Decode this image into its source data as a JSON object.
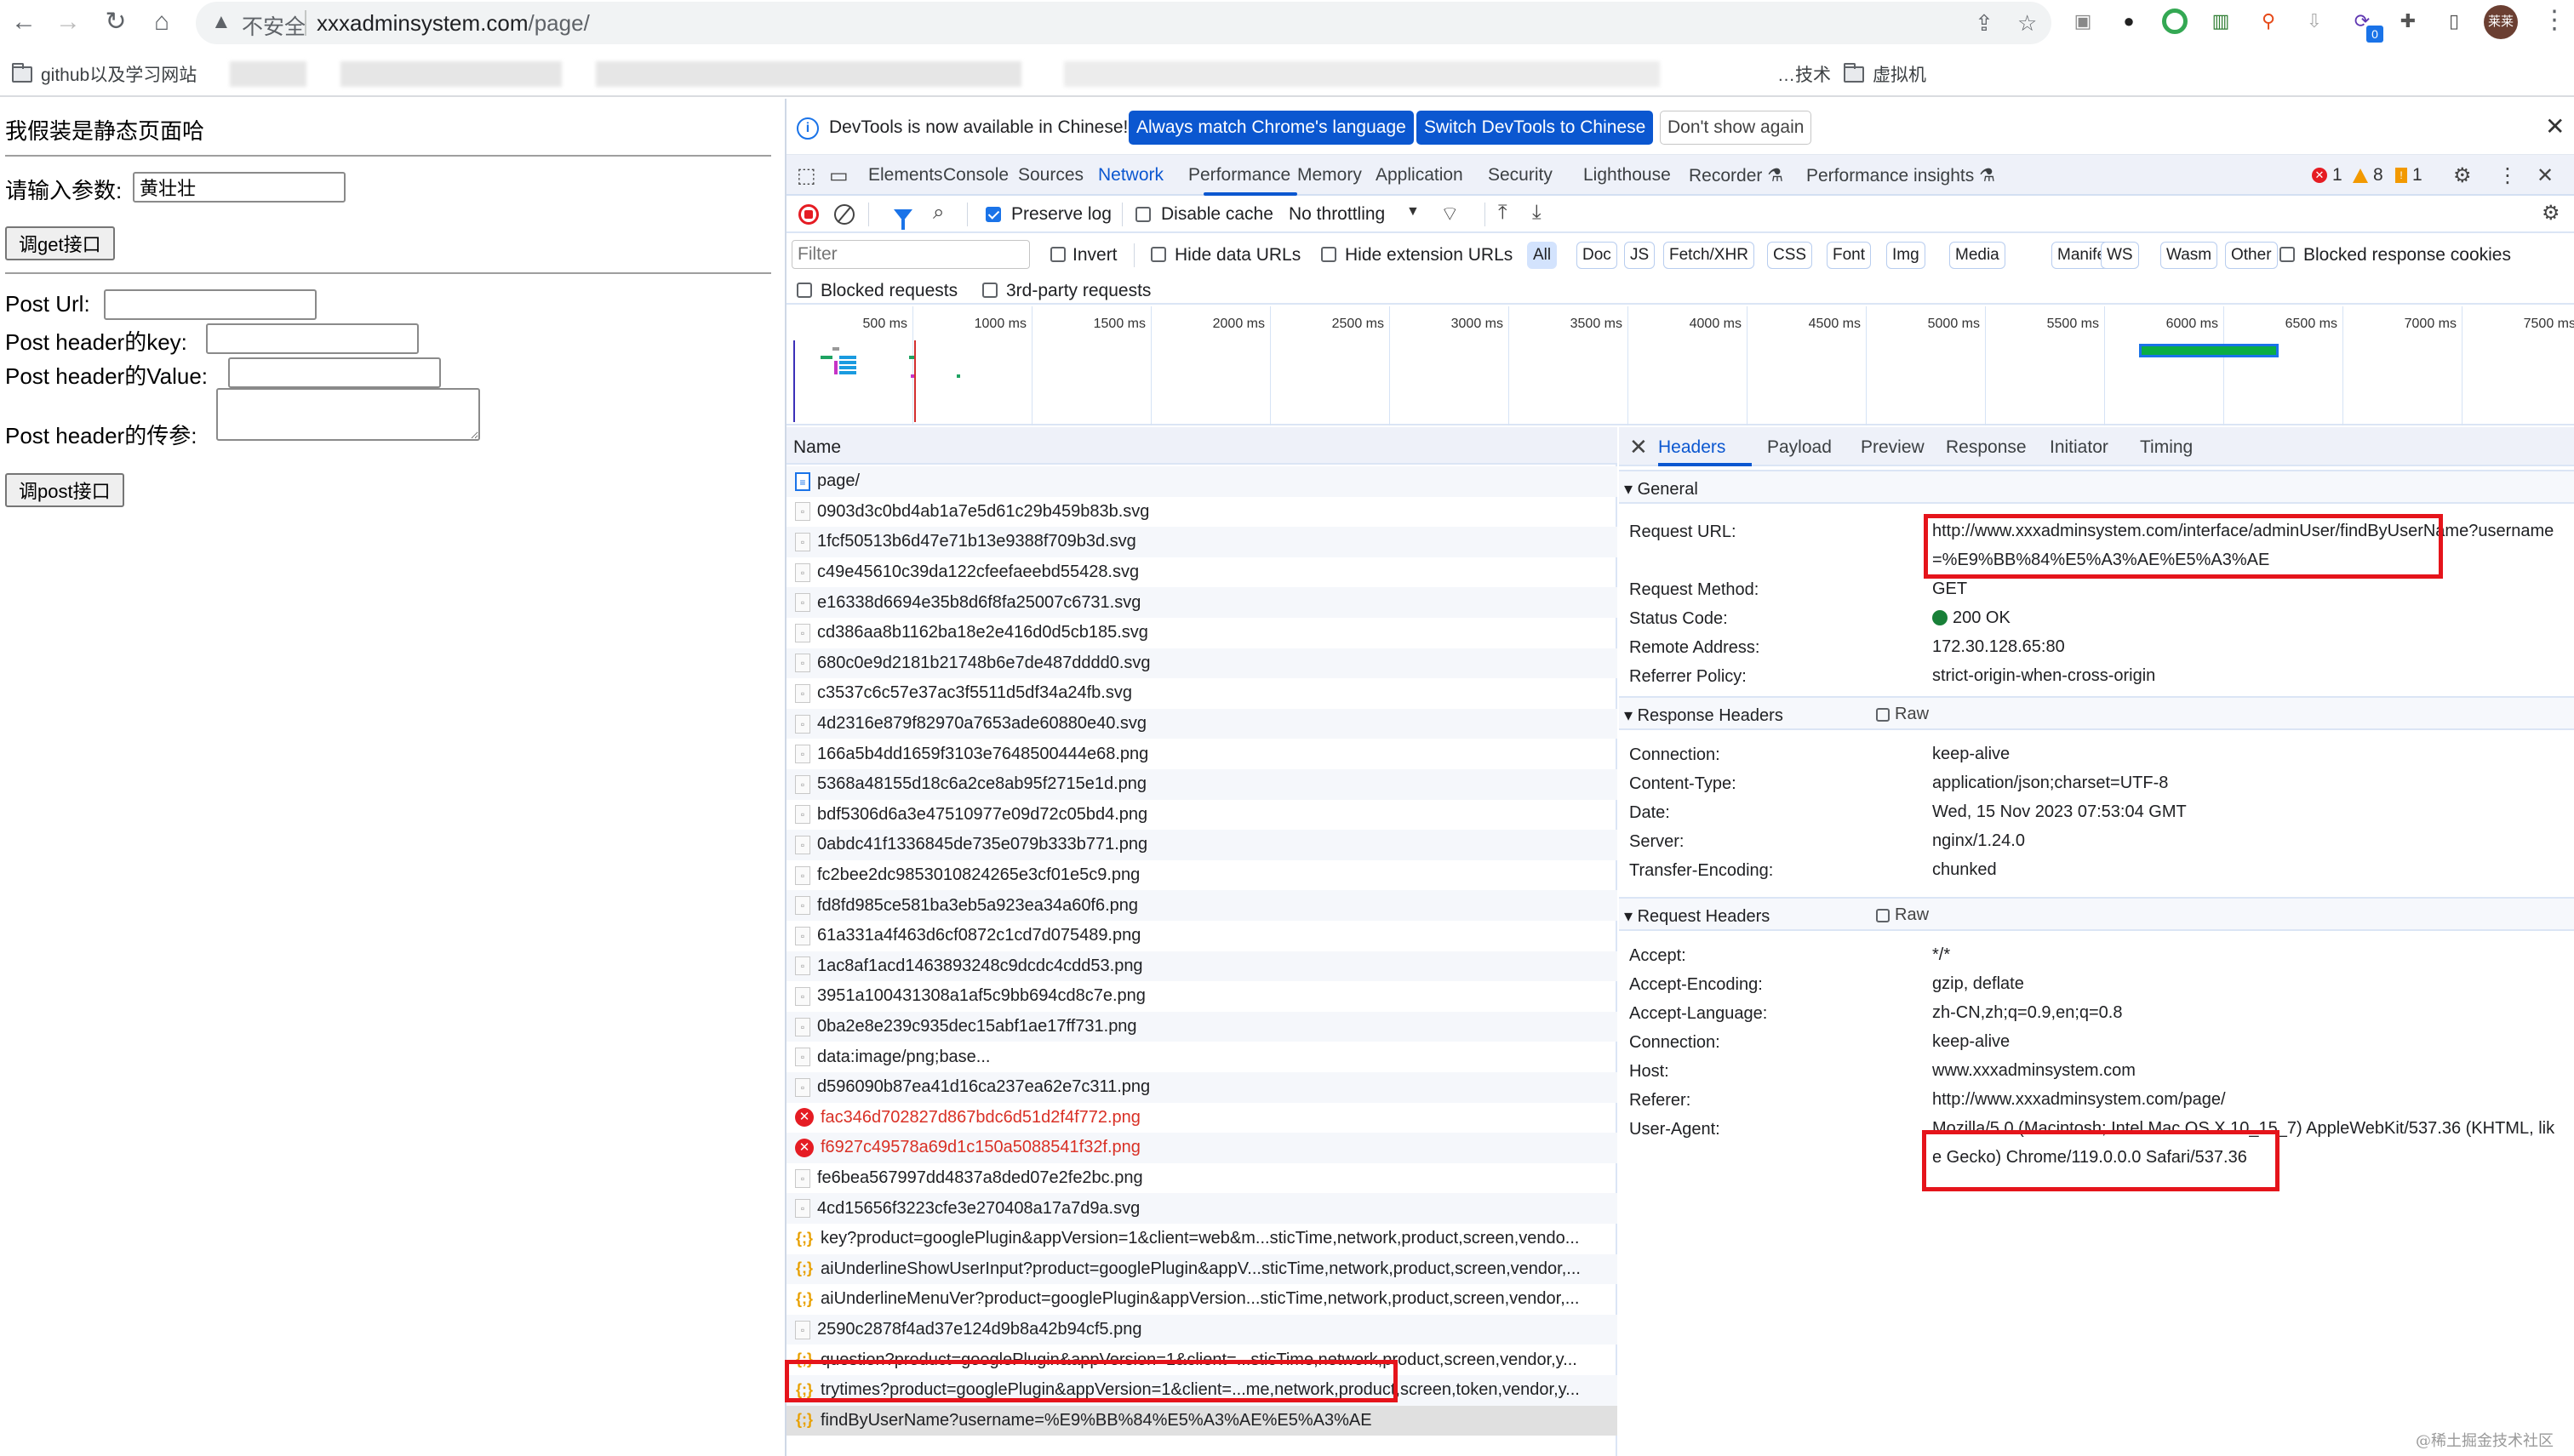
{
  "browser": {
    "security_label": "不安全",
    "url_host": "xxxadminsystem.com",
    "url_path": "/page/",
    "profile_initials": "莱莱",
    "extension_badge": "0",
    "bookmarks": [
      {
        "label": "github以及学习网站"
      },
      {
        "label": "…技术"
      },
      {
        "label": "虚拟机"
      }
    ]
  },
  "page": {
    "title": "我假装是静态页面哈",
    "param_label": "请输入参数:",
    "param_value": "黄壮壮",
    "get_button": "调get接口",
    "post_url_label": "Post Url:",
    "post_key_label": "Post header的key:",
    "post_value_label": "Post header的Value:",
    "post_body_label": "Post header的传参:",
    "post_button": "调post接口"
  },
  "devtools": {
    "infobar": {
      "text": "DevTools is now available in Chinese!",
      "btn_match": "Always match Chrome's language",
      "btn_switch": "Switch DevTools to Chinese",
      "btn_dismiss": "Don't show again"
    },
    "tabs": [
      "Elements",
      "Console",
      "Sources",
      "Network",
      "Performance",
      "Memory",
      "Application",
      "Security",
      "Lighthouse",
      "Recorder ⚗",
      "Performance insights ⚗"
    ],
    "active_tab": "Network",
    "counts": {
      "errors": "1",
      "warnings": "8",
      "issues": "1"
    },
    "toolbar": {
      "preserve_log": "Preserve log",
      "preserve_log_checked": true,
      "disable_cache": "Disable cache",
      "disable_cache_checked": false,
      "throttling": "No throttling"
    },
    "filter": {
      "placeholder": "Filter",
      "invert": "Invert",
      "hide_data_urls": "Hide data URLs",
      "hide_extension_urls": "Hide extension URLs",
      "types": [
        "All",
        "Doc",
        "JS",
        "Fetch/XHR",
        "CSS",
        "Font",
        "Img",
        "Media",
        "Manifest",
        "WS",
        "Wasm",
        "Other"
      ],
      "active_type": "All",
      "blocked_response_cookies": "Blocked response cookies",
      "blocked_requests": "Blocked requests",
      "third_party": "3rd-party requests"
    },
    "overview": {
      "ticks": [
        "500 ms",
        "1000 ms",
        "1500 ms",
        "2000 ms",
        "2500 ms",
        "3000 ms",
        "3500 ms",
        "4000 ms",
        "4500 ms",
        "5000 ms",
        "5500 ms",
        "6000 ms",
        "6500 ms",
        "7000 ms",
        "7500 ms"
      ]
    },
    "requests": {
      "column_name": "Name",
      "rows": [
        {
          "name": "page/",
          "type": "doc"
        },
        {
          "name": "0903d3c0bd4ab1a7e5d61c29b459b83b.svg",
          "type": "img"
        },
        {
          "name": "1fcf50513b6d47e71b13e9388f709b3d.svg",
          "type": "img"
        },
        {
          "name": "c49e45610c39da122cfeefaeebd55428.svg",
          "type": "img"
        },
        {
          "name": "e16338d6694e35b8d6f8fa25007c6731.svg",
          "type": "img"
        },
        {
          "name": "cd386aa8b1162ba18e2e416d0d5cb185.svg",
          "type": "img"
        },
        {
          "name": "680c0e9d2181b21748b6e7de487dddd0.svg",
          "type": "img"
        },
        {
          "name": "c3537c6c57e37ac3f5511d5df34a24fb.svg",
          "type": "img"
        },
        {
          "name": "4d2316e879f82970a7653ade60880e40.svg",
          "type": "img"
        },
        {
          "name": "166a5b4dd1659f3103e7648500444e68.png",
          "type": "img"
        },
        {
          "name": "5368a48155d18c6a2ce8ab95f2715e1d.png",
          "type": "img"
        },
        {
          "name": "bdf5306d6a3e47510977e09d72c05bd4.png",
          "type": "img"
        },
        {
          "name": "0abdc41f1336845de735e079b333b771.png",
          "type": "img"
        },
        {
          "name": "fc2bee2dc9853010824265e3cf01e5c9.png",
          "type": "img"
        },
        {
          "name": "fd8fd985ce581ba3eb5a923ea34a60f6.png",
          "type": "img"
        },
        {
          "name": "61a331a4f463d6cf0872c1cd7d075489.png",
          "type": "img"
        },
        {
          "name": "1ac8af1acd1463893248c9dcdc4cdd53.png",
          "type": "img"
        },
        {
          "name": "3951a100431308a1af5c9bb694cd8c7e.png",
          "type": "img"
        },
        {
          "name": "0ba2e8e239c935dec15abf1ae17ff731.png",
          "type": "img"
        },
        {
          "name": "data:image/png;base...",
          "type": "img"
        },
        {
          "name": "d596090b87ea41d16ca237ea62e7c311.png",
          "type": "img"
        },
        {
          "name": "fac346d702827d867bdc6d51d2f4f772.png",
          "type": "error"
        },
        {
          "name": "f6927c49578a69d1c150a5088541f32f.png",
          "type": "error"
        },
        {
          "name": "fe6bea567997dd4837a8ded07e2fe2bc.png",
          "type": "img"
        },
        {
          "name": "4cd15656f3223cfe3e270408a17a7d9a.svg",
          "type": "img"
        },
        {
          "name": "key?product=googlePlugin&appVersion=1&client=web&m...sticTime,network,product,screen,vendo...",
          "type": "xhr"
        },
        {
          "name": "aiUnderlineShowUserInput?product=googlePlugin&appV...sticTime,network,product,screen,vendor,...",
          "type": "xhr"
        },
        {
          "name": "aiUnderlineMenuVer?product=googlePlugin&appVersion...sticTime,network,product,screen,vendor,...",
          "type": "xhr"
        },
        {
          "name": "2590c2878f4ad37e124d9b8a42b94cf5.png",
          "type": "img"
        },
        {
          "name": "question?product=googlePlugin&appVersion=1&client=...sticTime,network,product,screen,vendor,y...",
          "type": "xhr"
        },
        {
          "name": "trytimes?product=googlePlugin&appVersion=1&client=...me,network,product,screen,token,vendor,y...",
          "type": "xhr"
        },
        {
          "name": "findByUserName?username=%E9%BB%84%E5%A3%AE%E5%A3%AE",
          "type": "xhr",
          "selected": true
        }
      ]
    },
    "details": {
      "tabs": [
        "Headers",
        "Payload",
        "Preview",
        "Response",
        "Initiator",
        "Timing"
      ],
      "active_tab": "Headers",
      "general": {
        "title": "General",
        "rows": [
          {
            "key": "Request URL:",
            "value": "http://www.xxxadminsystem.com/interface/adminUser/findByUserName?username=%E9%BB%84%E5%A3%AE%E5%A3%AE"
          },
          {
            "key": "Request Method:",
            "value": "GET"
          },
          {
            "key": "Status Code:",
            "value": "200 OK"
          },
          {
            "key": "Remote Address:",
            "value": "172.30.128.65:80"
          },
          {
            "key": "Referrer Policy:",
            "value": "strict-origin-when-cross-origin"
          }
        ]
      },
      "response_headers": {
        "title": "Response Headers",
        "raw_label": "Raw",
        "rows": [
          {
            "key": "Connection:",
            "value": "keep-alive"
          },
          {
            "key": "Content-Type:",
            "value": "application/json;charset=UTF-8"
          },
          {
            "key": "Date:",
            "value": "Wed, 15 Nov 2023 07:53:04 GMT"
          },
          {
            "key": "Server:",
            "value": "nginx/1.24.0"
          },
          {
            "key": "Transfer-Encoding:",
            "value": "chunked"
          }
        ]
      },
      "request_headers": {
        "title": "Request Headers",
        "raw_label": "Raw",
        "rows": [
          {
            "key": "Accept:",
            "value": "*/*"
          },
          {
            "key": "Accept-Encoding:",
            "value": "gzip, deflate"
          },
          {
            "key": "Accept-Language:",
            "value": "zh-CN,zh;q=0.9,en;q=0.8"
          },
          {
            "key": "Connection:",
            "value": "keep-alive"
          },
          {
            "key": "Host:",
            "value": "www.xxxadminsystem.com"
          },
          {
            "key": "Referer:",
            "value": "http://www.xxxadminsystem.com/page/"
          },
          {
            "key": "User-Agent:",
            "value": "Mozilla/5.0 (Macintosh; Intel Mac OS X 10_15_7) AppleWebKit/537.36 (KHTML, like Gecko) Chrome/119.0.0.0 Safari/537.36"
          }
        ]
      }
    }
  },
  "watermark": "@稀土掘金技术社区"
}
